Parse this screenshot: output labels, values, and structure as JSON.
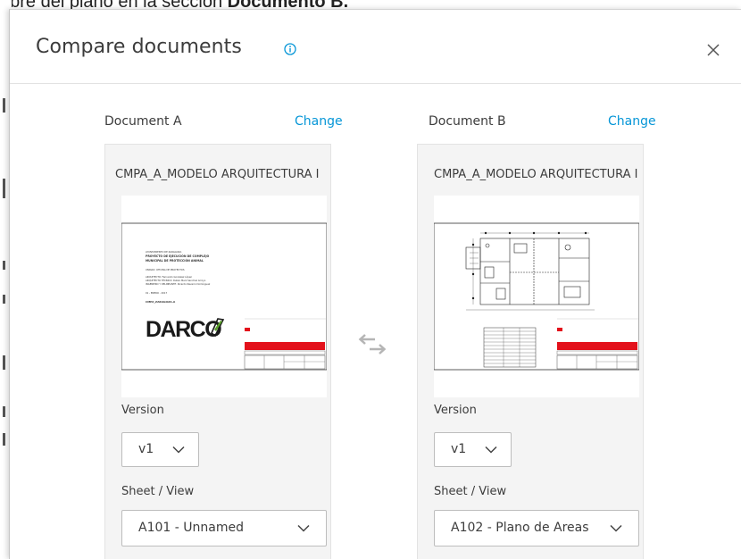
{
  "background": {
    "caption_text": "nbre del plano en la sección ",
    "caption_bold": "Documento B."
  },
  "dialog": {
    "title": "Compare documents",
    "info_icon": "info-icon",
    "close_icon": "close-icon"
  },
  "doc_a": {
    "label": "Document A",
    "change_label": "Change",
    "filename": "CMPA_A_MODELO ARQUITECTURA I",
    "version_label": "Version",
    "version_value": "v1",
    "sheet_label": "Sheet / View",
    "sheet_value": "A101 - Unnamed",
    "thumbnail": {
      "logo_text": "DARCO",
      "cover_lines": [
        "AYUNTAMIENTO DE ZARAGOZA",
        "PROYECTO DE EJECUCIÓN DE COMPLEJO",
        "MUNICIPAL DE PROTECCIÓN ANIMAL",
        "UNIDAD: OFICINA DE PROYECTOS",
        "ARQUITECTO: Fernando Gonzalez López",
        "ARQUITECTO TÉCNICO: Rubén Merz Sanchez Arroyo",
        "INGENIERO Y DELINEANTE: Ricardo Navarro Domínguez",
        "01 - ENERO - 2017",
        "CMPA_ZARAGOZA-A"
      ]
    }
  },
  "doc_b": {
    "label": "Document B",
    "change_label": "Change",
    "filename": "CMPA_A_MODELO ARQUITECTURA I",
    "version_label": "Version",
    "version_value": "v1",
    "sheet_label": "Sheet / View",
    "sheet_value": "A102 - Plano de Areas"
  },
  "swap_icon": "swap-arrows-icon",
  "colors": {
    "accent": "#0696d7",
    "card_bg": "#f4f4f4",
    "title_block_red": "#e3111b"
  }
}
